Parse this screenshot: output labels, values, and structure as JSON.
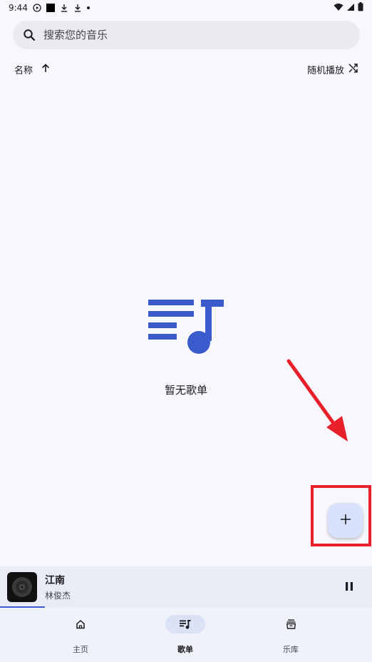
{
  "status_bar": {
    "time": "9:44"
  },
  "search": {
    "placeholder": "搜索您的音乐"
  },
  "sort": {
    "name_label": "名称",
    "shuffle_label": "随机播放"
  },
  "empty_state": {
    "text": "暂无歌单"
  },
  "now_playing": {
    "title": "江南",
    "artist": "林俊杰",
    "progress": 0.12
  },
  "nav": {
    "items": [
      {
        "label": "主页",
        "icon": "home-icon",
        "active": false
      },
      {
        "label": "歌单",
        "icon": "playlist-icon",
        "active": true
      },
      {
        "label": "乐库",
        "icon": "library-icon",
        "active": false
      }
    ]
  },
  "colors": {
    "accent": "#3b5bcc",
    "fab": "#d8e2fc",
    "highlight": "#e8202a"
  }
}
